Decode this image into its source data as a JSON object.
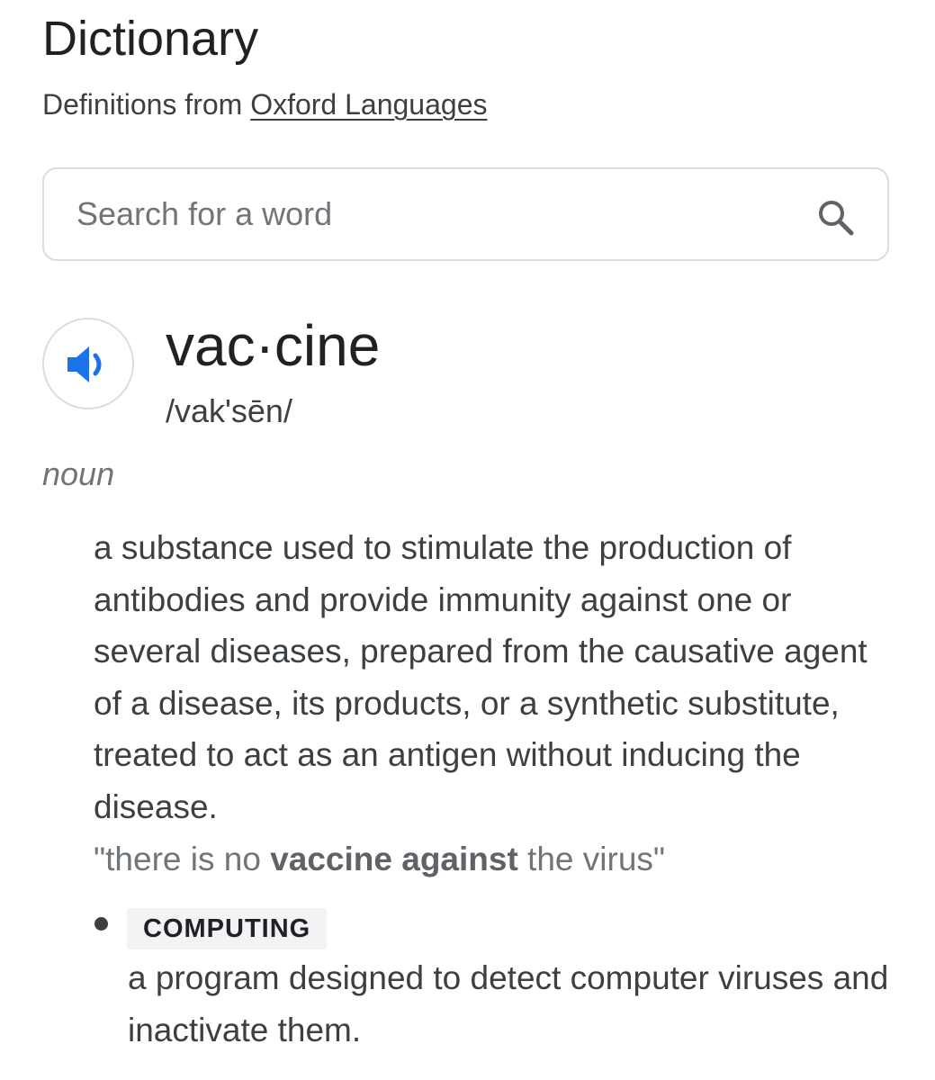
{
  "header": {
    "title": "Dictionary",
    "source_prefix": "Definitions from",
    "source_link": "Oxford Languages"
  },
  "search": {
    "placeholder": "Search for a word",
    "value": "",
    "icon": "search-icon"
  },
  "entry": {
    "speaker_icon": "speaker-icon",
    "headword": "vac·cine",
    "pronunciation": "/vak'sēn/",
    "part_of_speech": "noun",
    "definition": "a substance used to stimulate the production of antibodies and provide immunity against one or several diseases, prepared from the causative agent of a disease, its products, or a synthetic substitute, treated to act as an antigen without inducing the disease.",
    "example": {
      "open_quote": "\"there is no ",
      "bold": "vaccine against",
      "close": " the virus\""
    },
    "sub_senses": [
      {
        "label": "COMPUTING",
        "definition": "a program designed to detect computer viruses and inactivate them."
      }
    ]
  },
  "colors": {
    "text_primary": "#202124",
    "text_secondary": "#3c4043",
    "text_muted": "#70757a",
    "border": "#dadce0",
    "speaker_blue": "#1a73e8",
    "badge_bg": "#f1f3f4"
  }
}
